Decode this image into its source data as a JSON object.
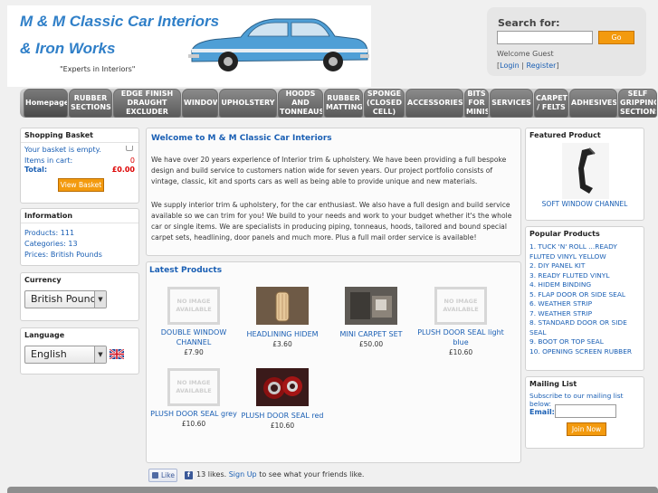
{
  "header": {
    "logo_line1": "M & M Classic Car Interiors",
    "logo_line2": "& Iron Works",
    "tagline": "\"Experts in Interiors\""
  },
  "search": {
    "title": "Search for:",
    "value": "",
    "go_label": "Go",
    "welcome": "Welcome Guest",
    "login_label": "Login",
    "separator": "|",
    "register_label": "Register",
    "bracket_open": "[",
    "bracket_close": "]"
  },
  "nav": {
    "items": [
      {
        "label": "Homepage"
      },
      {
        "label": "RUBBER SECTIONS"
      },
      {
        "label": "EDGE FINISH DRAUGHT EXCLUDER"
      },
      {
        "label": "WINDOW"
      },
      {
        "label": "UPHOLSTERY"
      },
      {
        "label": "HOODS AND TONNEAUS"
      },
      {
        "label": "RUBBER MATTING"
      },
      {
        "label": "SPONGE (CLOSED CELL)"
      },
      {
        "label": "ACCESSORIES"
      },
      {
        "label": "BITS FOR MINIS"
      },
      {
        "label": "SERVICES"
      },
      {
        "label": "CARPET / FELTS"
      },
      {
        "label": "ADHESIVES"
      },
      {
        "label": "SELF GRIPPING SECTIONS"
      }
    ]
  },
  "basket": {
    "title": "Shopping Basket",
    "empty_text": "Your basket is empty.",
    "items_label": "Items in cart:",
    "items_value": "0",
    "total_label": "Total:",
    "total_value": "£0.00",
    "view_label": "View Basket"
  },
  "information": {
    "title": "Information",
    "products_line": "Products: 111",
    "categories_line": "Categories: 13",
    "prices_line": "Prices: British Pounds"
  },
  "currency": {
    "title": "Currency",
    "selected": "British Pounds"
  },
  "language": {
    "title": "Language",
    "selected": "English"
  },
  "welcome": {
    "title": "Welcome to M & M Classic Car Interiors",
    "p1": "We have over 20 years experience of Interior trim & upholstery. We have been providing a full bespoke design and build service to customers nation wide for seven years. Our project portfolio consists of vintage, classic, kit and sports cars as well as being able to provide unique and new materials.",
    "p2": "We supply interior trim & upholstery, for the car enthusiast. We also have a full design and build service available so we can trim for you! We build to your needs and work to your budget whether it's the whole car or single items. We are specialists in producing piping, tonneaus, hoods, tailored and bound special carpet sets, headlining, door panels and much more. Plus a full mail order service is available!"
  },
  "latest": {
    "title": "Latest Products",
    "no_image_lines": [
      "NO IMAGE",
      "AVAILABLE"
    ],
    "products": [
      {
        "name": "DOUBLE WINDOW CHANNEL",
        "price": "£7.90",
        "image": "no-image"
      },
      {
        "name": "HEADLINING HIDEM",
        "price": "£3.60",
        "image": "photo"
      },
      {
        "name": "MINI CARPET SET",
        "price": "£50.00",
        "image": "photo"
      },
      {
        "name": "PLUSH DOOR SEAL light blue",
        "price": "£10.60",
        "image": "no-image"
      },
      {
        "name": "PLUSH DOOR SEAL grey",
        "price": "£10.60",
        "image": "no-image"
      },
      {
        "name": "PLUSH DOOR SEAL red",
        "price": "£10.60",
        "image": "photo"
      }
    ]
  },
  "social": {
    "like_label": "Like",
    "fb_letter": "f",
    "likes_text": "13 likes.",
    "signup_label": "Sign Up",
    "after_text": "to see what your friends like."
  },
  "featured": {
    "title": "Featured Product",
    "name": "SOFT WINDOW CHANNEL"
  },
  "popular": {
    "title": "Popular Products",
    "items": [
      "1. TUCK 'N' ROLL ...READY FLUTED VINYL YELLOW",
      "2. DIY PANEL KIT",
      "3. READY FLUTED VINYL",
      "4. HIDEM BINDING",
      "5. FLAP DOOR OR SIDE SEAL",
      "6. WEATHER STRIP",
      "7. WEATHER STRIP",
      "8. STANDARD DOOR OR SIDE SEAL",
      "9. BOOT OR TOP SEAL",
      "10. OPENING SCREEN RUBBER"
    ]
  },
  "mailing": {
    "title": "Mailing List",
    "text": "Subscribe to our mailing list below:",
    "email_label": "Email:",
    "email_value": "",
    "join_label": "Join Now"
  },
  "colors": {
    "brand_blue": "#2f7fc8",
    "link_blue": "#1a5fb4",
    "button_orange": "#f39a0e",
    "nav_grey": "#6a6a6a"
  }
}
